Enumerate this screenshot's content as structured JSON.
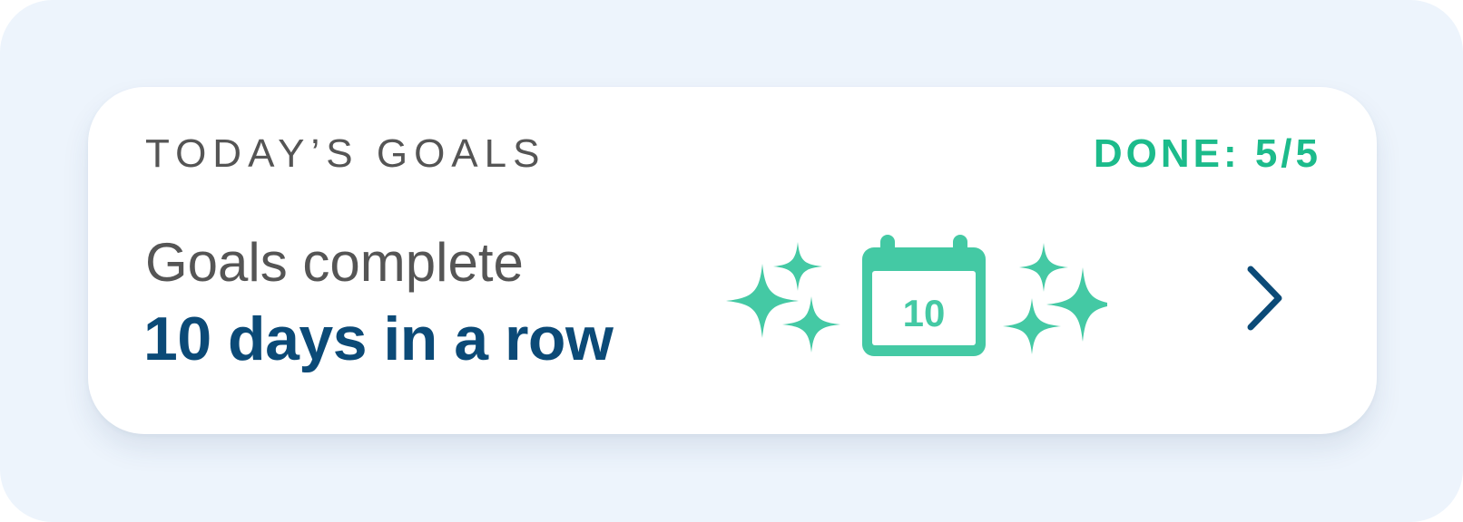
{
  "card": {
    "header_title": "TODAY’S GOALS",
    "status": "DONE: 5/5",
    "subtitle": "Goals complete",
    "streak_text": "10 days in a row",
    "calendar_number": "10"
  },
  "icons": {
    "sparkles": "sparkles-icon",
    "calendar": "calendar-icon",
    "chevron": "chevron-right-icon"
  },
  "colors": {
    "background": "#edf4fc",
    "card": "#ffffff",
    "header_text": "#555555",
    "status_green": "#1cbb8b",
    "streak_blue": "#0b4a77",
    "illustration_teal": "#44c9a4",
    "chevron": "#0b4a77"
  }
}
